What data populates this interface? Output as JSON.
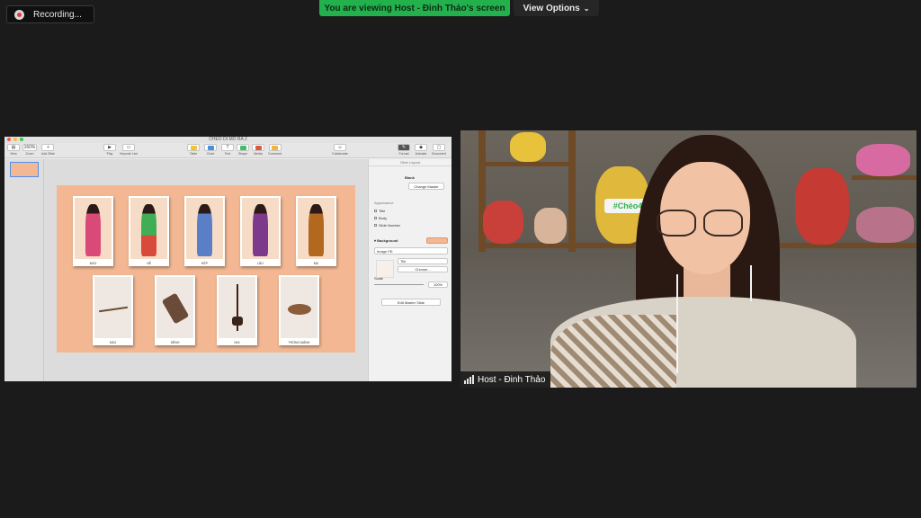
{
  "recording": {
    "label": "Recording..."
  },
  "banner": {
    "text": "You are viewing Host - Đinh Thảo's screen"
  },
  "view_options": {
    "label": "View Options"
  },
  "keynote": {
    "doc_title": "CHEO DI MO RA 2",
    "toolbar": [
      {
        "label": "View",
        "icon": "view-icon"
      },
      {
        "label": "Zoom",
        "value": "160%"
      },
      {
        "label": "Add Slide",
        "icon": "plus-icon"
      },
      {
        "label": "Play",
        "icon": "play-icon"
      },
      {
        "label": "Keynote Live",
        "icon": "keynote-live-icon"
      },
      {
        "label": "Table",
        "icon": "table-icon"
      },
      {
        "label": "Chart",
        "icon": "chart-icon"
      },
      {
        "label": "Text",
        "icon": "text-icon"
      },
      {
        "label": "Shape",
        "icon": "shape-icon"
      },
      {
        "label": "Media",
        "icon": "media-icon"
      },
      {
        "label": "Comment",
        "icon": "comment-icon"
      },
      {
        "label": "Collaborate",
        "icon": "collaborate-icon"
      },
      {
        "label": "Format",
        "icon": "format-icon"
      },
      {
        "label": "Animate",
        "icon": "animate-icon"
      },
      {
        "label": "Document",
        "icon": "document-icon"
      }
    ],
    "cards_top": [
      "ĐÀO",
      "HỀ",
      "KÉP",
      "LÃO",
      "MỤ"
    ],
    "cards_bottom": [
      "SÁO",
      "SÊNH",
      "NHỊ",
      "TRỐNG MẢNH"
    ],
    "inspector": {
      "header": "Slide Layout",
      "master_name": "Blank",
      "change_master": "Change Master",
      "appearance": "Appearance",
      "opt_title": "Title",
      "opt_body": "Body",
      "opt_slide_number": "Slide Number",
      "background": "Background",
      "fill_type": "Image Fill",
      "fill_mode": "Tile",
      "choose": "Choose...",
      "scale": "Scale",
      "scale_value": "100%",
      "edit_master": "Edit Master Slide"
    }
  },
  "video": {
    "sign_text": "#Chèo4",
    "name": "Host - Đinh Thảo"
  },
  "colors": {
    "banner_green": "#22b14c",
    "slide_bg": "#f3b893",
    "background": "#1b1b1b"
  }
}
